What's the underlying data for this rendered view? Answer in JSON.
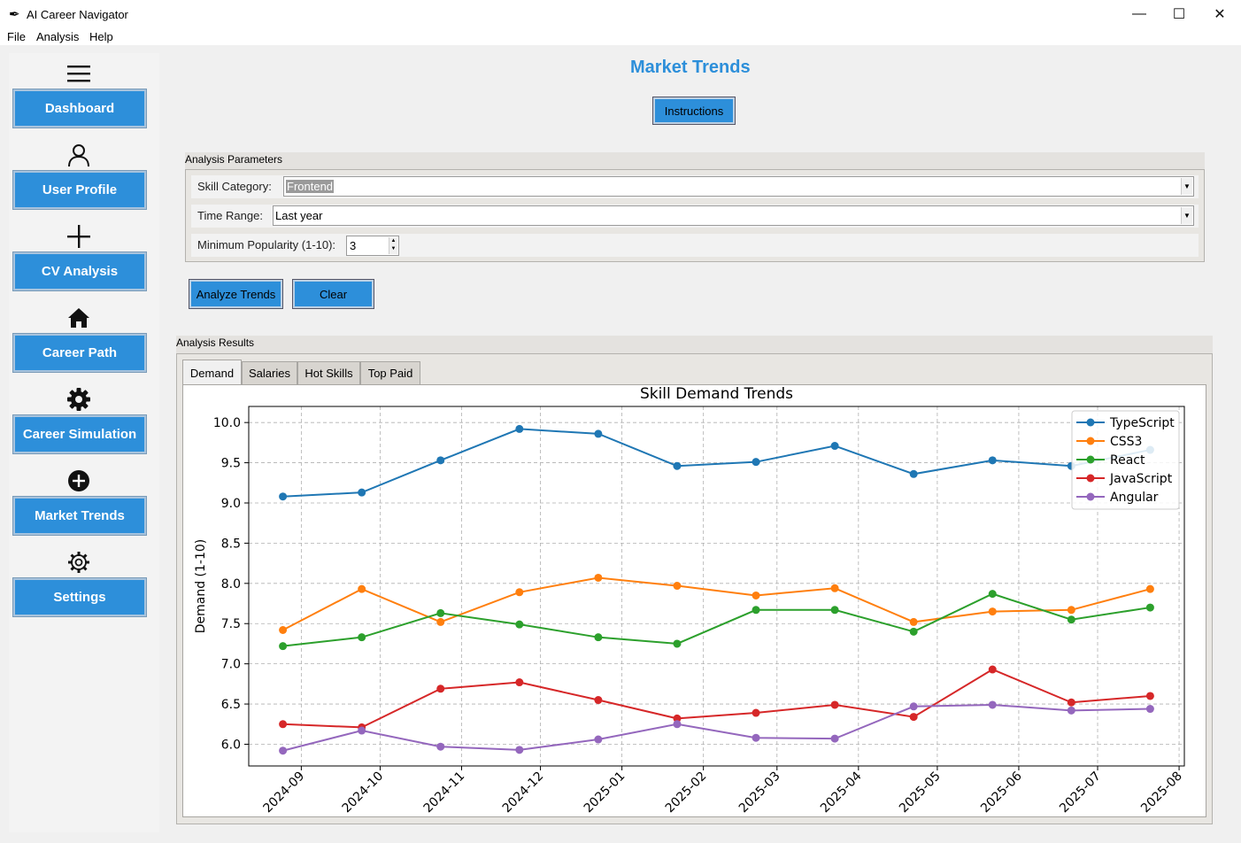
{
  "window": {
    "title": "AI Career Navigator",
    "app_icon": "feather-icon",
    "controls": [
      "minimize-icon",
      "maximize-icon",
      "close-icon"
    ]
  },
  "menu": {
    "items": [
      "File",
      "Analysis",
      "Help"
    ]
  },
  "sidebar": {
    "items": [
      {
        "icon": "hamburger-icon",
        "label": "Dashboard"
      },
      {
        "icon": "user-icon",
        "label": "User Profile"
      },
      {
        "icon": "plus-icon",
        "label": "CV Analysis"
      },
      {
        "icon": "home-icon",
        "label": "Career Path"
      },
      {
        "icon": "gear-filled-icon",
        "label": "Career Simulation"
      },
      {
        "icon": "plus-circle-icon",
        "label": "Market Trends"
      },
      {
        "icon": "gear-outline-icon",
        "label": "Settings"
      }
    ]
  },
  "page": {
    "title": "Market Trends",
    "instructions_label": "Instructions",
    "params_title": "Analysis Parameters",
    "skill_category_label": "Skill Category:",
    "skill_category_value": "Frontend",
    "time_range_label": "Time Range:",
    "time_range_value": "Last year",
    "min_popularity_label": "Minimum Popularity (1-10):",
    "min_popularity_value": "3",
    "analyze_label": "Analyze Trends",
    "clear_label": "Clear",
    "results_title": "Analysis Results",
    "tabs": [
      "Demand",
      "Salaries",
      "Hot Skills",
      "Top Paid"
    ],
    "active_tab": "Demand"
  },
  "colors": {
    "accent": "#2d8fda",
    "button_text": "#ffffff"
  },
  "chart_data": {
    "type": "line",
    "title": "Skill Demand Trends",
    "xlabel": "",
    "ylabel": "Demand (1-10)",
    "x": [
      "2024-08-25",
      "2024-09-24",
      "2024-10-24",
      "2024-11-23",
      "2024-12-23",
      "2025-01-22",
      "2025-02-21",
      "2025-03-23",
      "2025-04-22",
      "2025-05-22",
      "2025-06-21",
      "2025-07-21"
    ],
    "x_ticks": [
      "2024-09",
      "2024-10",
      "2024-11",
      "2024-12",
      "2025-01",
      "2025-02",
      "2025-03",
      "2025-04",
      "2025-05",
      "2025-06",
      "2025-07",
      "2025-08"
    ],
    "xlim": [
      "2024-08-12",
      "2025-08-03"
    ],
    "ylim": [
      5.73,
      10.2
    ],
    "y_ticks": [
      "6.0",
      "6.5",
      "7.0",
      "7.5",
      "8.0",
      "8.5",
      "9.0",
      "9.5",
      "10.0"
    ],
    "grid": true,
    "legend_position": "top-right",
    "series": [
      {
        "name": "TypeScript",
        "color": "#1f77b4",
        "values": [
          9.08,
          9.13,
          9.53,
          9.92,
          9.86,
          9.46,
          9.51,
          9.71,
          9.36,
          9.53,
          9.46,
          9.66
        ]
      },
      {
        "name": "CSS3",
        "color": "#ff7f0e",
        "values": [
          7.42,
          7.93,
          7.52,
          7.89,
          8.07,
          7.97,
          7.85,
          7.94,
          7.52,
          7.65,
          7.67,
          7.93
        ]
      },
      {
        "name": "React",
        "color": "#2ca02c",
        "values": [
          7.22,
          7.33,
          7.63,
          7.49,
          7.33,
          7.25,
          7.67,
          7.67,
          7.4,
          7.87,
          7.55,
          7.7
        ]
      },
      {
        "name": "JavaScript",
        "color": "#d62728",
        "values": [
          6.25,
          6.21,
          6.69,
          6.77,
          6.55,
          6.32,
          6.39,
          6.49,
          6.34,
          6.93,
          6.52,
          6.6
        ]
      },
      {
        "name": "Angular",
        "color": "#9467bd",
        "values": [
          5.92,
          6.17,
          5.97,
          5.93,
          6.06,
          6.25,
          6.08,
          6.07,
          6.47,
          6.49,
          6.42,
          6.44
        ]
      }
    ]
  }
}
